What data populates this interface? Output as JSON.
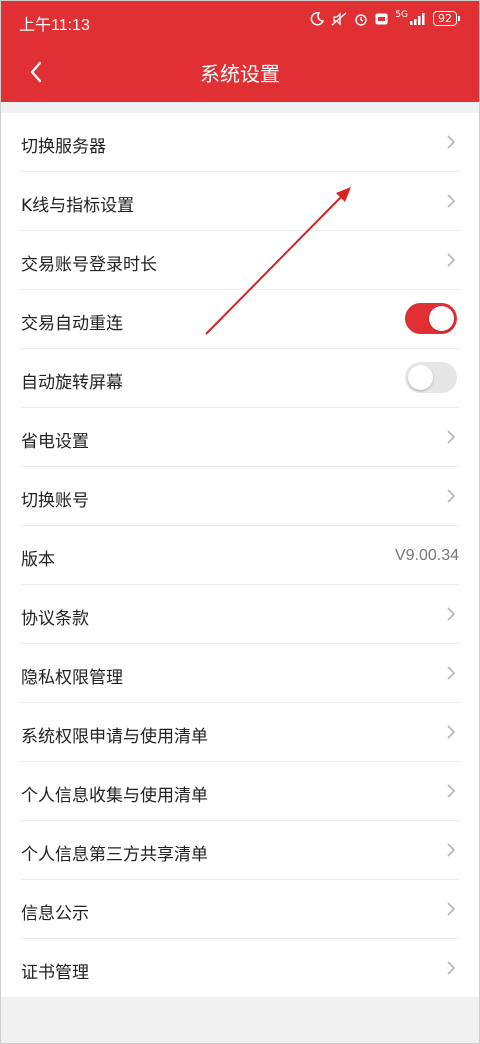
{
  "status_bar": {
    "time": "上午11:13",
    "network": "5G",
    "battery": "92",
    "icons": [
      "moon-icon",
      "mute-icon",
      "alarm-icon",
      "hd-icon",
      "signal-icon",
      "battery-icon"
    ]
  },
  "header": {
    "title": "系统设置",
    "back_icon": "chevron-left-icon"
  },
  "settings": {
    "items": [
      {
        "label": "切换服务器",
        "type": "link"
      },
      {
        "label": "K线与指标设置",
        "type": "link"
      },
      {
        "label": "交易账号登录时长",
        "type": "link"
      },
      {
        "label": "交易自动重连",
        "type": "toggle",
        "checked": true
      },
      {
        "label": "自动旋转屏幕",
        "type": "toggle",
        "checked": false
      },
      {
        "label": "省电设置",
        "type": "link"
      },
      {
        "label": "切换账号",
        "type": "link"
      },
      {
        "label": "版本",
        "type": "value",
        "value": "V9.00.34"
      },
      {
        "label": "协议条款",
        "type": "link"
      },
      {
        "label": "隐私权限管理",
        "type": "link"
      },
      {
        "label": "系统权限申请与使用清单",
        "type": "link"
      },
      {
        "label": "个人信息收集与使用清单",
        "type": "link"
      },
      {
        "label": "个人信息第三方共享清单",
        "type": "link"
      },
      {
        "label": "信息公示",
        "type": "link"
      },
      {
        "label": "证书管理",
        "type": "link"
      }
    ]
  },
  "colors": {
    "accent": "#e03034",
    "background": "#f1f1f1",
    "annotation_arrow": "#d62424"
  }
}
